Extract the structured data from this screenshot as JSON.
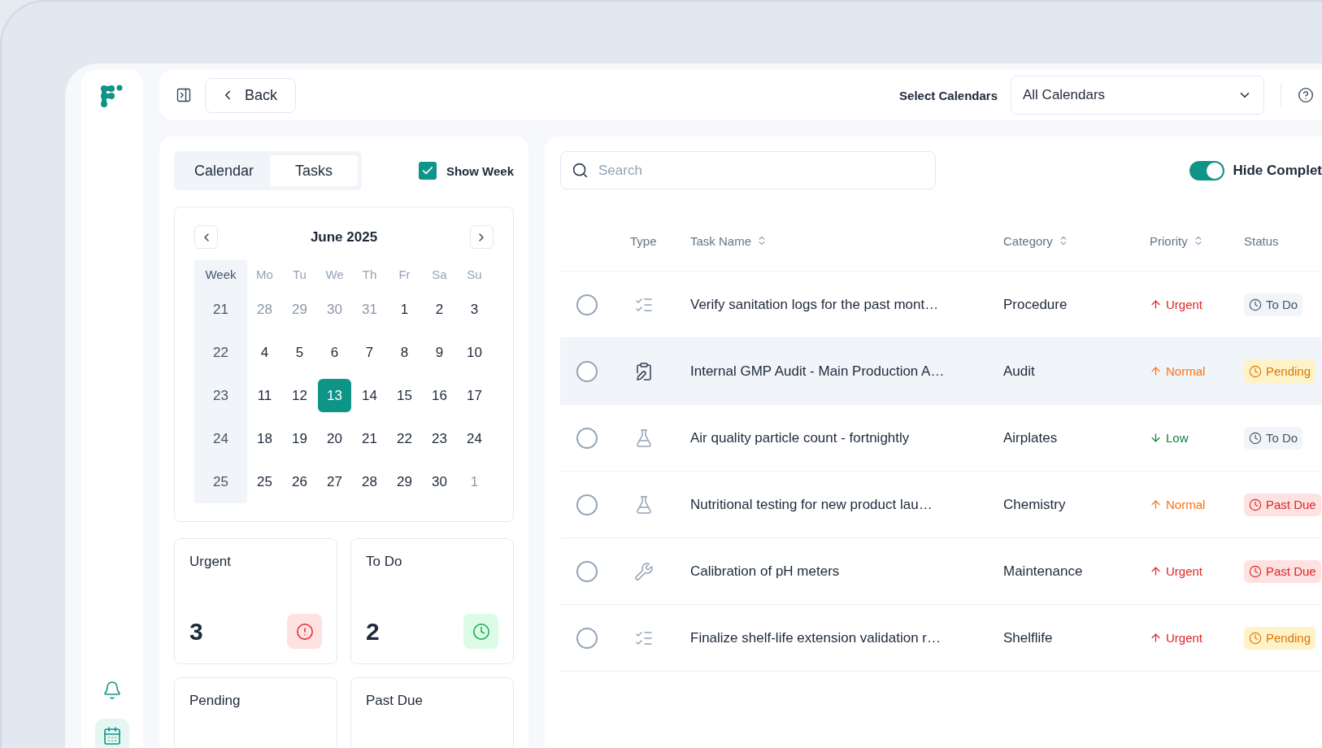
{
  "sidebar": {
    "items": [
      {
        "kind": "bell",
        "selected": false
      },
      {
        "kind": "calendar",
        "selected": true
      }
    ]
  },
  "topbar": {
    "back": "Back",
    "select_label": "Select Calendars",
    "select_value": "All Calendars"
  },
  "tabs": [
    {
      "label": "Calendar",
      "selected": false
    },
    {
      "label": "Tasks",
      "selected": true
    }
  ],
  "show_week": {
    "label": "Show Week",
    "checked": true
  },
  "calendar": {
    "title": "June 2025",
    "week_header": "Week",
    "weekdays": [
      "Mo",
      "Tu",
      "We",
      "Th",
      "Fr",
      "Sa",
      "Su"
    ],
    "weeks": [
      {
        "week": "21",
        "days": [
          {
            "label": "28",
            "muted": true,
            "selected": false
          },
          {
            "label": "29",
            "muted": true,
            "selected": false
          },
          {
            "label": "30",
            "muted": true,
            "selected": false
          },
          {
            "label": "31",
            "muted": true,
            "selected": false
          },
          {
            "label": "1",
            "muted": false,
            "selected": false
          },
          {
            "label": "2",
            "muted": false,
            "selected": false
          },
          {
            "label": "3",
            "muted": false,
            "selected": false
          }
        ]
      },
      {
        "week": "22",
        "days": [
          {
            "label": "4",
            "muted": false,
            "selected": false
          },
          {
            "label": "5",
            "muted": false,
            "selected": false
          },
          {
            "label": "6",
            "muted": false,
            "selected": false
          },
          {
            "label": "7",
            "muted": false,
            "selected": false
          },
          {
            "label": "8",
            "muted": false,
            "selected": false
          },
          {
            "label": "9",
            "muted": false,
            "selected": false
          },
          {
            "label": "10",
            "muted": false,
            "selected": false
          }
        ]
      },
      {
        "week": "23",
        "days": [
          {
            "label": "11",
            "muted": false,
            "selected": false
          },
          {
            "label": "12",
            "muted": false,
            "selected": false
          },
          {
            "label": "13",
            "muted": false,
            "selected": true
          },
          {
            "label": "14",
            "muted": false,
            "selected": false
          },
          {
            "label": "15",
            "muted": false,
            "selected": false
          },
          {
            "label": "16",
            "muted": false,
            "selected": false
          },
          {
            "label": "17",
            "muted": false,
            "selected": false
          }
        ]
      },
      {
        "week": "24",
        "days": [
          {
            "label": "18",
            "muted": false,
            "selected": false
          },
          {
            "label": "19",
            "muted": false,
            "selected": false
          },
          {
            "label": "20",
            "muted": false,
            "selected": false
          },
          {
            "label": "21",
            "muted": false,
            "selected": false
          },
          {
            "label": "22",
            "muted": false,
            "selected": false
          },
          {
            "label": "23",
            "muted": false,
            "selected": false
          },
          {
            "label": "24",
            "muted": false,
            "selected": false
          }
        ]
      },
      {
        "week": "25",
        "days": [
          {
            "label": "25",
            "muted": false,
            "selected": false
          },
          {
            "label": "26",
            "muted": false,
            "selected": false
          },
          {
            "label": "27",
            "muted": false,
            "selected": false
          },
          {
            "label": "28",
            "muted": false,
            "selected": false
          },
          {
            "label": "29",
            "muted": false,
            "selected": false
          },
          {
            "label": "30",
            "muted": false,
            "selected": false
          },
          {
            "label": "1",
            "muted": true,
            "selected": false
          }
        ]
      }
    ]
  },
  "stats": [
    {
      "kind": "urgent",
      "title": "Urgent",
      "count": "3"
    },
    {
      "kind": "todo",
      "title": "To Do",
      "count": "2"
    },
    {
      "kind": "pending",
      "title": "Pending"
    },
    {
      "kind": "pastdue",
      "title": "Past Due"
    }
  ],
  "search": {
    "placeholder": "Search"
  },
  "hide_completed": {
    "label": "Hide Complet",
    "on": true
  },
  "table": {
    "columns": [
      {
        "label": "Type",
        "sortable": false
      },
      {
        "label": "Task Name",
        "sortable": true
      },
      {
        "label": "Category",
        "sortable": true
      },
      {
        "label": "Priority",
        "sortable": true
      },
      {
        "label": "Status",
        "sortable": false
      }
    ],
    "rows": [
      {
        "kind": "checklist",
        "name": "Verify sanitation logs for the past mont…",
        "category": "Procedure",
        "priority": {
          "kind": "urgent",
          "label": "Urgent"
        },
        "status": {
          "kind": "todo",
          "label": "To Do"
        },
        "checked": false,
        "selected": false
      },
      {
        "kind": "audit",
        "name": "Internal GMP Audit - Main Production A…",
        "category": "Audit",
        "priority": {
          "kind": "normal",
          "label": "Normal"
        },
        "status": {
          "kind": "pending",
          "label": "Pending"
        },
        "checked": false,
        "selected": true
      },
      {
        "kind": "lab",
        "name": "Air quality particle count - fortnightly",
        "category": "Airplates",
        "priority": {
          "kind": "low",
          "label": "Low"
        },
        "status": {
          "kind": "todo",
          "label": "To Do"
        },
        "checked": false,
        "selected": false
      },
      {
        "kind": "lab",
        "name": "Nutritional testing for new product lau…",
        "category": "Chemistry",
        "priority": {
          "kind": "normal",
          "label": "Normal"
        },
        "status": {
          "kind": "pastdue",
          "label": "Past Due"
        },
        "checked": false,
        "selected": false
      },
      {
        "kind": "maintenance",
        "name": "Calibration of pH meters",
        "category": "Maintenance",
        "priority": {
          "kind": "urgent",
          "label": "Urgent"
        },
        "status": {
          "kind": "pastdue",
          "label": "Past Due"
        },
        "checked": false,
        "selected": false
      },
      {
        "kind": "checklist",
        "name": "Finalize shelf-life extension validation r…",
        "category": "Shelflife",
        "priority": {
          "kind": "urgent",
          "label": "Urgent"
        },
        "status": {
          "kind": "pending",
          "label": "Pending"
        },
        "checked": false,
        "selected": false
      }
    ]
  }
}
